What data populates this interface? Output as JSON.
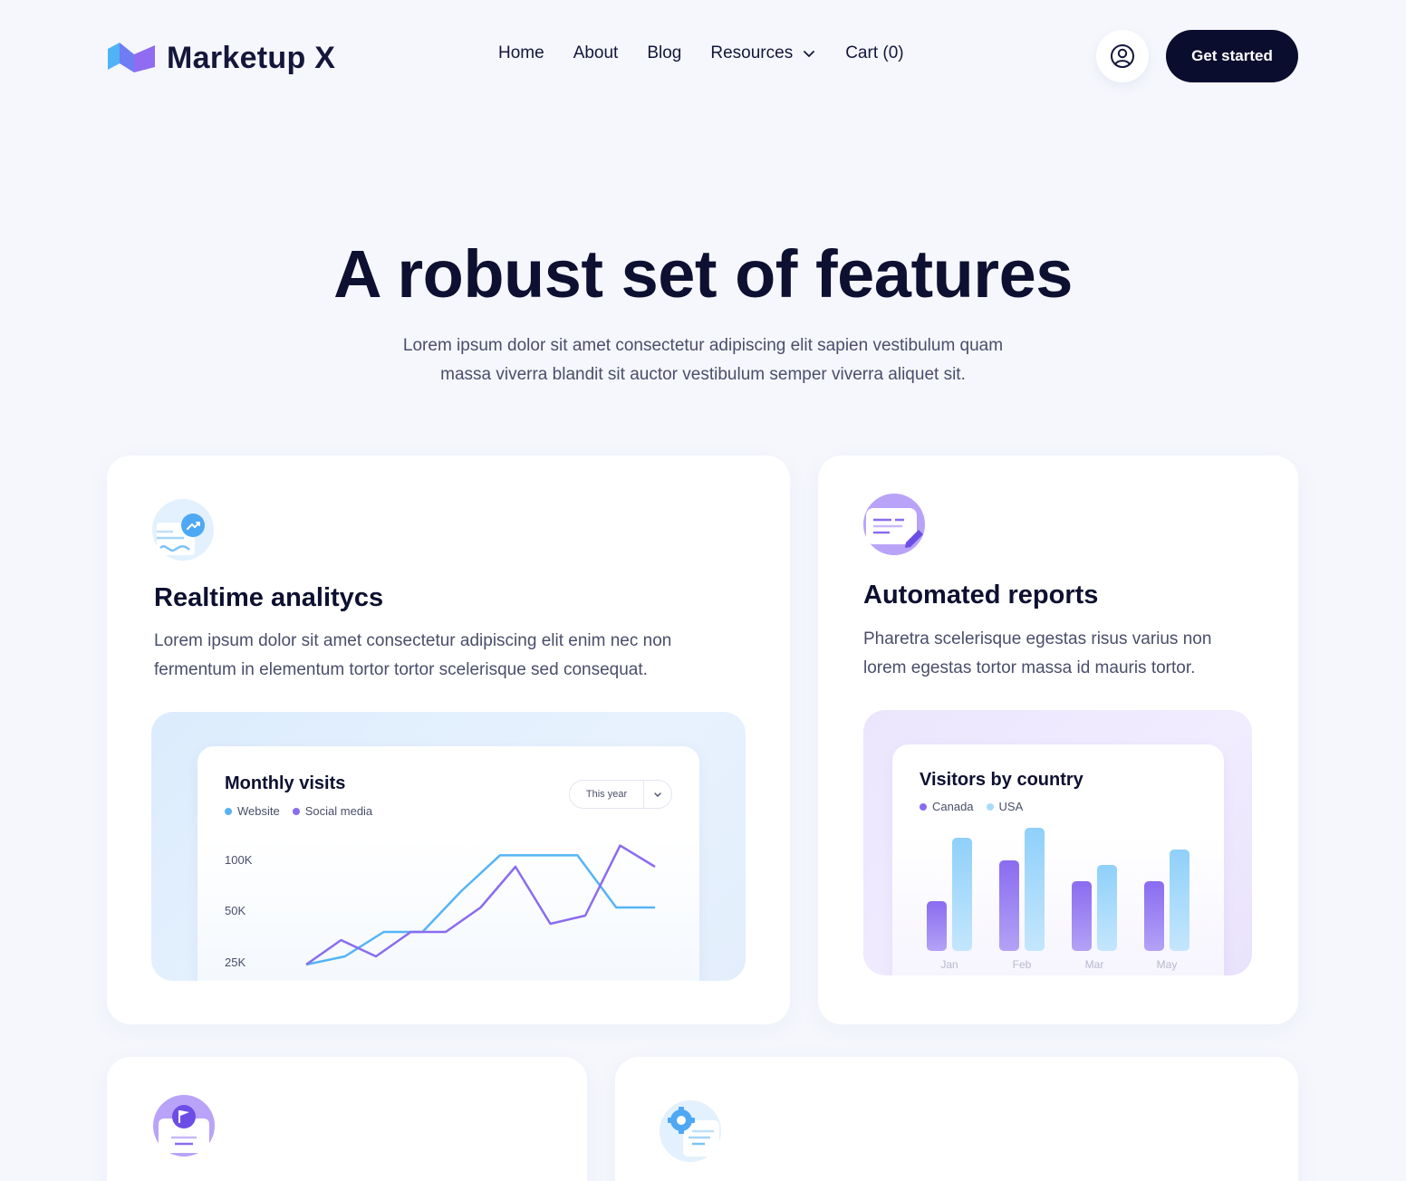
{
  "brand": {
    "name": "Marketup X"
  },
  "nav": {
    "links": [
      "Home",
      "About",
      "Blog",
      "Resources",
      "Cart (0)"
    ],
    "cta": "Get started"
  },
  "hero": {
    "title": "A robust set of features",
    "subtitle_line1": "Lorem ipsum dolor sit amet consectetur adipiscing elit sapien vestibulum quam",
    "subtitle_line2": "massa viverra blandit sit auctor vestibulum semper viverra aliquet sit."
  },
  "features": [
    {
      "title": "Realtime analitycs",
      "text_line1": "Lorem ipsum dolor sit amet consectetur adipiscing elit enim nec non",
      "text_line2": "fermentum in elementum tortor tortor scelerisque sed consequat.",
      "icon": "analytics-icon"
    },
    {
      "title": "Automated reports",
      "text_line1": "Pharetra scelerisque egestas risus varius non",
      "text_line2": "lorem egestas tortor massa id mauris tortor.",
      "icon": "report-icon"
    },
    {
      "icon": "flag-badge-icon"
    },
    {
      "icon": "settings-doc-icon"
    }
  ],
  "monthly_visits": {
    "title": "Monthly visits",
    "legend": [
      "Website",
      "Social media"
    ],
    "select_value": "This year",
    "yticks": [
      "100K",
      "50K",
      "25K"
    ]
  },
  "visitors": {
    "title": "Visitors by country",
    "legend": [
      "Canada",
      "USA"
    ]
  },
  "colors": {
    "dark": "#0b0d2e",
    "blue": "#56b4f5",
    "purple": "#8a6cf0",
    "light_blue": "#a9dbfb",
    "background": "#f5f7fd"
  },
  "chart_data": [
    {
      "type": "line",
      "title": "Monthly visits",
      "series": [
        {
          "name": "Website",
          "x": [
            1,
            2,
            3,
            4,
            5,
            6,
            7,
            8,
            9,
            10
          ],
          "values": [
            15000,
            20000,
            35000,
            35000,
            60000,
            82000,
            82000,
            82000,
            50000,
            50000
          ]
        },
        {
          "name": "Social media",
          "x": [
            1,
            2,
            3,
            4,
            5,
            6,
            7,
            8,
            9,
            10,
            11
          ],
          "values": [
            15000,
            30000,
            20000,
            35000,
            35000,
            50000,
            75000,
            40000,
            45000,
            88000,
            75000
          ]
        }
      ],
      "ylabel": "",
      "yticks": [
        "25K",
        "50K",
        "100K"
      ],
      "legend": "top-left"
    },
    {
      "type": "bar",
      "title": "Visitors by country",
      "categories": [
        "Jan",
        "Feb",
        "Mar",
        "May"
      ],
      "series": [
        {
          "name": "Canada",
          "values": [
            55,
            100,
            77,
            77
          ]
        },
        {
          "name": "USA",
          "values": [
            125,
            136,
            95,
            112
          ]
        }
      ],
      "legend": "top-left"
    }
  ]
}
